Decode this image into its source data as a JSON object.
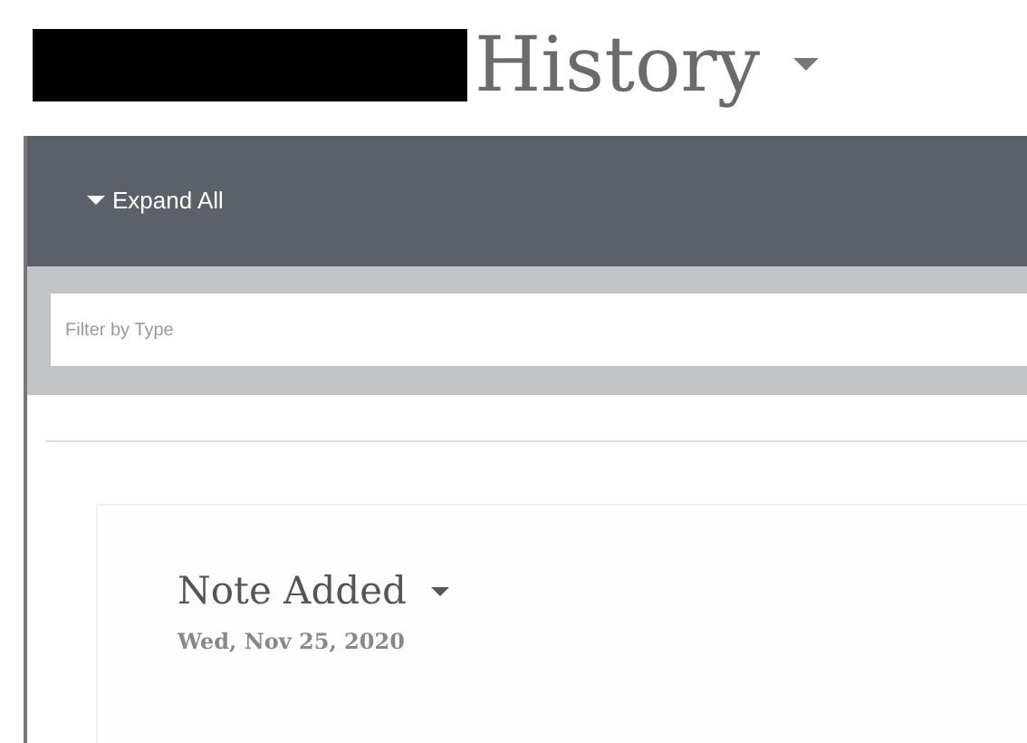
{
  "page": {
    "title": "History"
  },
  "toolbar": {
    "expand_all": "Expand All"
  },
  "filter": {
    "placeholder": "Filter by Type"
  },
  "events": [
    {
      "title": "Note Added",
      "date": "Wed, Nov 25, 2020"
    }
  ]
}
